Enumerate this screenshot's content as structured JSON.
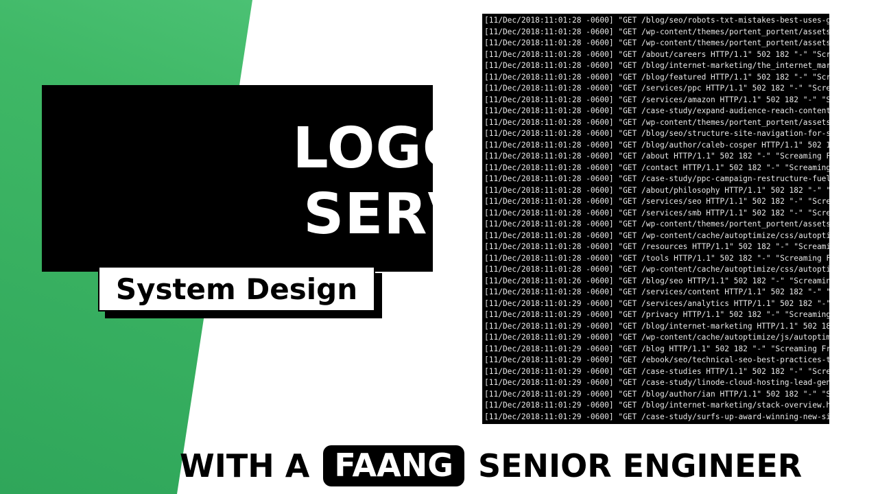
{
  "title": {
    "line1": "LOGGING",
    "line2": "SERVICE",
    "subtitle": "System Design"
  },
  "terminal": {
    "lines": [
      "[11/Dec/2018:11:01:28 -0600] \"GET /blog/seo/robots-txt-mistakes-best-uses-guid",
      "[11/Dec/2018:11:01:28 -0600] \"GET /wp-content/themes/portent_portent/assets/st",
      "[11/Dec/2018:11:01:28 -0600] \"GET /wp-content/themes/portent_portent/assets/st",
      "[11/Dec/2018:11:01:28 -0600] \"GET /about/careers HTTP/1.1\" 502 182 \"-\" \"Screa",
      "[11/Dec/2018:11:01:28 -0600] \"GET /blog/internet-marketing/the_internet_market",
      "[11/Dec/2018:11:01:28 -0600] \"GET /blog/featured HTTP/1.1\" 502 182 \"-\" \"Scream",
      "[11/Dec/2018:11:01:28 -0600] \"GET /services/ppc HTTP/1.1\" 502 182 \"-\" \"Screami",
      "[11/Dec/2018:11:01:28 -0600] \"GET /services/amazon HTTP/1.1\" 502 182 \"-\" \"Scre",
      "[11/Dec/2018:11:01:28 -0600] \"GET /case-study/expand-audience-reach-content-st",
      "[11/Dec/2018:11:01:28 -0600] \"GET /wp-content/themes/portent_portent/assets/st",
      "[11/Dec/2018:11:01:28 -0600] \"GET /blog/seo/structure-site-navigation-for-seo-",
      "[11/Dec/2018:11:01:28 -0600] \"GET /blog/author/caleb-cosper HTTP/1.1\" 502 182 ",
      "[11/Dec/2018:11:01:28 -0600] \"GET /about HTTP/1.1\" 502 182 \"-\" \"Screaming Frog",
      "[11/Dec/2018:11:01:28 -0600] \"GET /contact HTTP/1.1\" 502 182 \"-\" \"Screaming Fr",
      "[11/Dec/2018:11:01:28 -0600] \"GET /case-study/ppc-campaign-restructure-fuels-m",
      "[11/Dec/2018:11:01:28 -0600] \"GET /about/philosophy HTTP/1.1\" 502 182 \"-\" \"Sc",
      "[11/Dec/2018:11:01:28 -0600] \"GET /services/seo HTTP/1.1\" 502 182 \"-\" \"Scream",
      "[11/Dec/2018:11:01:28 -0600] \"GET /services/smb HTTP/1.1\" 502 182 \"-\" \"Screami",
      "[11/Dec/2018:11:01:28 -0600] \"GET /wp-content/themes/portent_portent/assets/st",
      "[11/Dec/2018:11:01:28 -0600] \"GET /wp-content/cache/autoptimize/css/autoptimiz",
      "[11/Dec/2018:11:01:28 -0600] \"GET /resources HTTP/1.1\" 502 182 \"-\" \"Screaming",
      "[11/Dec/2018:11:01:28 -0600] \"GET /tools HTTP/1.1\" 502 182 \"-\" \"Screaming Frog",
      "[11/Dec/2018:11:01:28 -0600] \"GET /wp-content/cache/autoptimize/css/autoptimiz",
      "[11/Dec/2018:11:01:26 -0600] \"GET /blog/seo HTTP/1.1\" 502 182 \"-\" \"Screaming ",
      "[11/Dec/2018:11:01:28 -0600] \"GET /services/content HTTP/1.1\" 502 182 \"-\" \"Sc",
      "[11/Dec/2018:11:01:29 -0600] \"GET /services/analytics HTTP/1.1\" 502 182 \"-\" \"S",
      "[11/Dec/2018:11:01:29 -0600] \"GET /privacy HTTP/1.1\" 502 182 \"-\" \"Screaming F",
      "[11/Dec/2018:11:01:29 -0600] \"GET /blog/internet-marketing HTTP/1.1\" 502 182 \"",
      "[11/Dec/2018:11:01:29 -0600] \"GET /wp-content/cache/autoptimize/js/autoptimize",
      "[11/Dec/2018:11:01:29 -0600] \"GET /blog HTTP/1.1\" 502 182 \"-\" \"Screaming Frog ",
      "[11/Dec/2018:11:01:29 -0600] \"GET /ebook/seo/technical-seo-best-practices-the-",
      "[11/Dec/2018:11:01:29 -0600] \"GET /case-studies HTTP/1.1\" 502 182 \"-\" \"Scream",
      "[11/Dec/2018:11:01:29 -0600] \"GET /case-study/linode-cloud-hosting-lead-genera",
      "[11/Dec/2018:11:01:29 -0600] \"GET /blog/author/ian HTTP/1.1\" 502 182 \"-\" \"Scre",
      "[11/Dec/2018:11:01:29 -0600] \"GET /blog/internet-marketing/stack-overview.htm",
      "[11/Dec/2018:11:01:29 -0600] \"GET /case-study/surfs-up-award-winning-new-site-"
    ]
  },
  "banner": {
    "prefix": "WITH A",
    "highlight": "FAANG",
    "suffix": "SENIOR ENGINEER"
  },
  "colors": {
    "green_light": "#5fd08a",
    "green_dark": "#2fa65a",
    "black": "#000000",
    "white": "#ffffff"
  }
}
